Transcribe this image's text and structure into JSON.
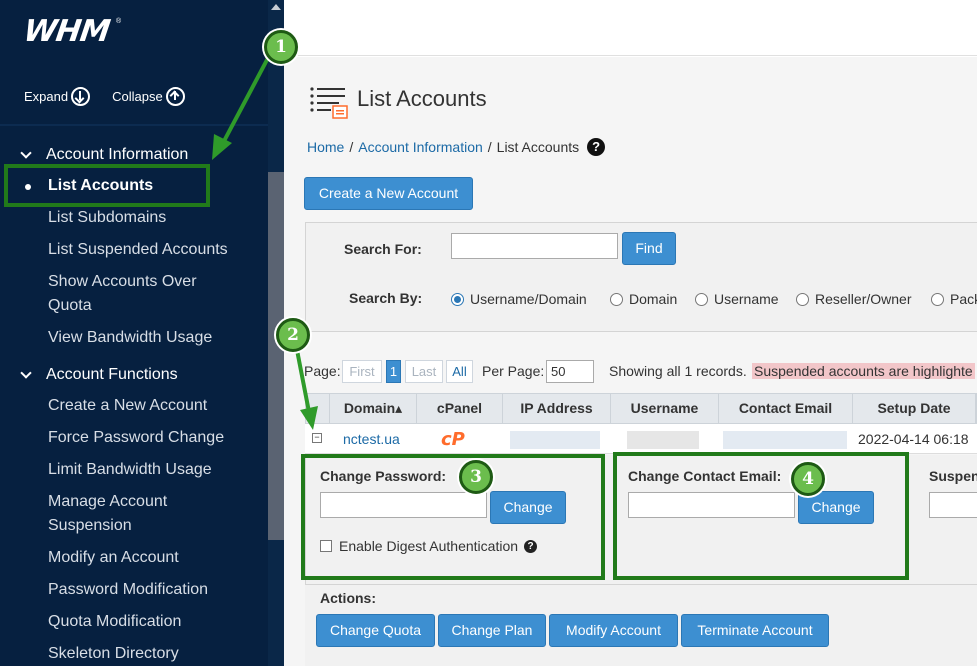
{
  "sidebar": {
    "logo": "WHM",
    "logo_mark": "®",
    "expand_label": "Expand",
    "collapse_label": "Collapse",
    "sections": [
      {
        "title": "Account Information",
        "items": [
          "List Accounts",
          "List Subdomains",
          "List Suspended Accounts",
          "Show Accounts Over Quota",
          "View Bandwidth Usage"
        ]
      },
      {
        "title": "Account Functions",
        "items": [
          "Create a New Account",
          "Force Password Change",
          "Limit Bandwidth Usage",
          "Manage Account Suspension",
          "Modify an Account",
          "Password Modification",
          "Quota Modification",
          "Skeleton Directory"
        ]
      }
    ],
    "active_item": "List Accounts"
  },
  "page": {
    "title": "List Accounts",
    "breadcrumb": [
      "Home",
      "Account Information",
      "List Accounts"
    ],
    "help_glyph": "?",
    "create_button": "Create a New Account"
  },
  "search": {
    "for_label": "Search For:",
    "value": "",
    "find_button": "Find",
    "by_label": "Search By:",
    "options": [
      "Username/Domain",
      "Domain",
      "Username",
      "Reseller/Owner",
      "Pack"
    ],
    "selected": "Username/Domain"
  },
  "pager": {
    "page_label": "Page:",
    "first": "First",
    "current": "1",
    "last": "Last",
    "all": "All",
    "per_page_label": "Per Page:",
    "per_page_value": "50",
    "showing": "Showing all 1 records.",
    "suspended_note": "Suspended accounts are highlighte"
  },
  "table": {
    "headers": [
      "Domain",
      "cPanel",
      "IP Address",
      "Username",
      "Contact Email",
      "Setup Date"
    ],
    "sort_arrow": "▴",
    "row": {
      "expander": "−",
      "domain": "nctest.ua",
      "cpanel_logo": "cP",
      "setup_date": "2022-04-14 06:18"
    }
  },
  "details": {
    "change_password_label": "Change Password:",
    "change_button": "Change",
    "digest_label": "Enable Digest Authentication",
    "change_email_label": "Change Contact Email:",
    "email_change_button": "Change",
    "suspend_label": "Suspen"
  },
  "actions": {
    "label": "Actions:",
    "buttons": [
      "Change Quota",
      "Change Plan",
      "Modify Account",
      "Terminate Account"
    ]
  },
  "annotations": {
    "badges": [
      "1",
      "2",
      "3",
      "4"
    ],
    "highlight_color": "#217a1a",
    "badge_color": "#6bbd4d"
  },
  "colors": {
    "sidebar_bg": "#062040",
    "primary_button": "#3d8fd1",
    "link": "#1c6aa6",
    "suspended_bg": "#f2c6c9",
    "cpanel_orange": "#ff6c2c"
  }
}
